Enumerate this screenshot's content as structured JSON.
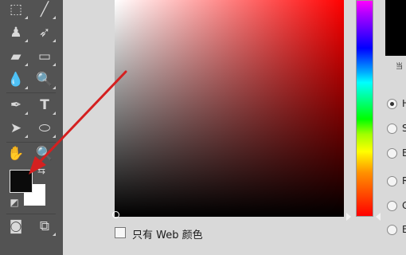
{
  "toolbar": {
    "tools": [
      {
        "name": "marquee-tool-icon",
        "glyph": "⬚"
      },
      {
        "name": "brush-tool-icon",
        "glyph": "╱"
      },
      {
        "name": "stamp-tool-icon",
        "glyph": "♟"
      },
      {
        "name": "history-brush-icon",
        "glyph": "➶"
      },
      {
        "name": "eraser-tool-icon",
        "glyph": "▰"
      },
      {
        "name": "gradient-tool-icon",
        "glyph": "▭"
      },
      {
        "name": "blur-tool-icon",
        "glyph": "💧"
      },
      {
        "name": "dodge-tool-icon",
        "glyph": "🔍"
      },
      {
        "name": "pen-tool-icon",
        "glyph": "✒"
      },
      {
        "name": "type-tool-icon",
        "glyph": "T"
      },
      {
        "name": "path-selection-icon",
        "glyph": "➤"
      },
      {
        "name": "ellipse-tool-icon",
        "glyph": "⬭"
      },
      {
        "name": "hand-tool-icon",
        "glyph": "✋"
      },
      {
        "name": "zoom-tool-icon",
        "glyph": "🔍"
      },
      {
        "name": "swap-colors-icon",
        "glyph": "⇆"
      },
      {
        "name": "default-colors-icon",
        "glyph": "◩"
      },
      {
        "name": "quick-mask-icon",
        "glyph": "◙"
      },
      {
        "name": "screen-mode-icon",
        "glyph": "⧉"
      }
    ],
    "foreground_color": "#0b0b0b",
    "background_color": "#ffffff"
  },
  "color_picker": {
    "current_hue_color": "#ff0000",
    "preview_color": "#000000",
    "preview_caption": "当",
    "radio_options": [
      {
        "letter": "H",
        "checked": true
      },
      {
        "letter": "S",
        "checked": false
      },
      {
        "letter": "B",
        "checked": false
      },
      {
        "letter": "R",
        "checked": false
      },
      {
        "letter": "G",
        "checked": false
      },
      {
        "letter": "B",
        "checked": false
      }
    ],
    "web_only_label": "只有 Web 颜色"
  },
  "annotation": {
    "color": "#d42020"
  }
}
